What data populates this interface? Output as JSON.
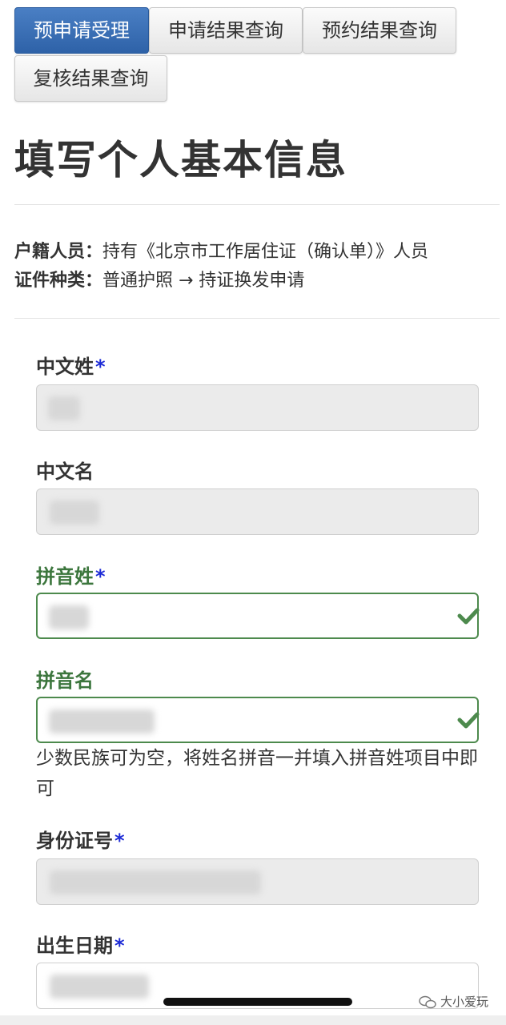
{
  "tabs": [
    {
      "label": "预申请受理",
      "active": true
    },
    {
      "label": "申请结果查询",
      "active": false
    },
    {
      "label": "预约结果查询",
      "active": false
    },
    {
      "label": "复核结果查询",
      "active": false
    }
  ],
  "page_title": "填写个人基本信息",
  "info": {
    "household_label": "户籍人员：",
    "household_value": "持有《北京市工作居住证（确认单）》人员",
    "doc_type_label": "证件种类：",
    "doc_type_value": "普通护照 → 持证换发申请"
  },
  "form": {
    "cn_surname_label": "中文姓",
    "cn_given_label": "中文名",
    "py_surname_label": "拼音姓",
    "py_given_label": "拼音名",
    "py_help": "少数民族可为空，将姓名拼音一并填入拼音姓项目中即可",
    "id_number_label": "身份证号",
    "birth_date_label": "出生日期",
    "required_mark": "*"
  },
  "colors": {
    "active_tab": "#2e62a8",
    "valid_green": "#3c763d",
    "required_blue": "#1d2bd6"
  },
  "icons": [
    "check-icon",
    "wechat-icon"
  ],
  "watermark": "大小爱玩"
}
